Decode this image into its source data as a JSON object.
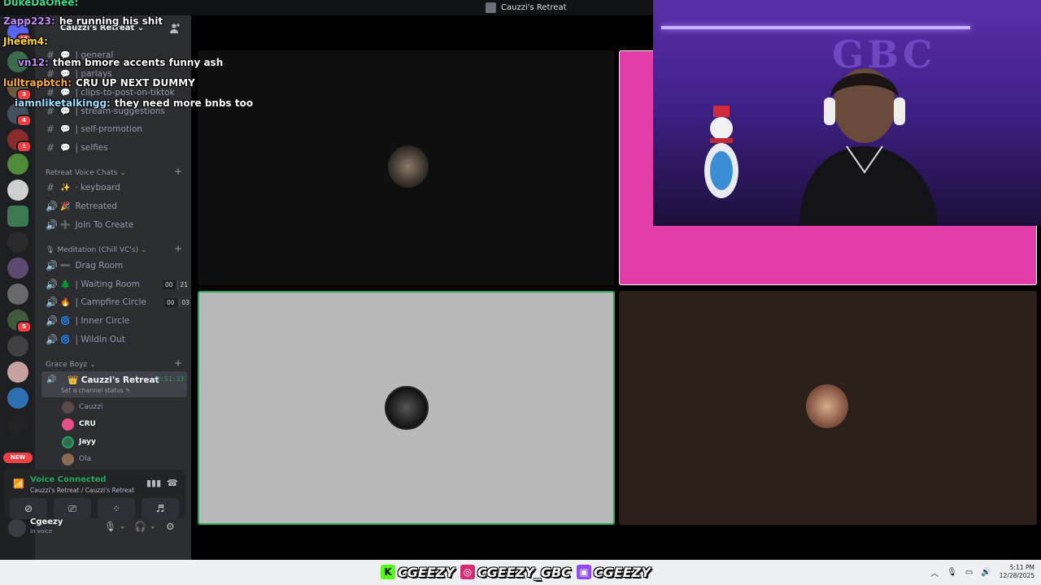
{
  "window": {
    "title": "Cauzzi's Retreat"
  },
  "servers": {
    "badges": [
      "15",
      "3",
      "4",
      "1",
      "5"
    ],
    "new_label": "NEW"
  },
  "server_header": {
    "name": "Cauzzi's Retreat"
  },
  "channels": {
    "text": [
      {
        "emoji": "💬",
        "label": "| general"
      },
      {
        "emoji": "💬",
        "label": "| parlays"
      },
      {
        "emoji": "💬",
        "label": "| clips-to-post-on-tiktok"
      },
      {
        "emoji": "💬",
        "label": "| stream-suggestions"
      },
      {
        "emoji": "💬",
        "label": "| self-promotion"
      },
      {
        "emoji": "💬",
        "label": "| selfies"
      }
    ],
    "cat_retreat": "Retreat Voice Chats",
    "retreat": [
      {
        "emoji": "✨",
        "label": "· keyboard",
        "icon": "#"
      },
      {
        "emoji": "🎉",
        "label": "Retreated",
        "icon": "🔊"
      },
      {
        "emoji": "➕",
        "label": "Join To Create",
        "icon": "🔊"
      }
    ],
    "cat_meditation": "Meditation (Chill VC's)",
    "meditation": [
      {
        "emoji": "➖",
        "label": "Drag Room",
        "c1": "",
        "c2": ""
      },
      {
        "emoji": "🌲",
        "label": "| Waiting Room",
        "c1": "00",
        "c2": "21"
      },
      {
        "emoji": "🔥",
        "label": "| Campfire Circle",
        "c1": "00",
        "c2": "03"
      },
      {
        "emoji": "🌀",
        "label": "| Inner Circle",
        "c1": "",
        "c2": ""
      },
      {
        "emoji": "🌀",
        "label": "| Wildin Out",
        "c1": "",
        "c2": ""
      }
    ],
    "cat_grace": "Grace Boyz",
    "active": {
      "name": "Cauzzi's Retreat",
      "timer": "3:51:33",
      "status": "Set a channel status"
    },
    "members": [
      "Cauzzi",
      "CRU",
      "Jayy",
      "Ola"
    ]
  },
  "voice": {
    "title": "Voice Connected",
    "sub": "Cauzzi's Retreat / Cauzzi's Retreat"
  },
  "user": {
    "name": "Cgeezy",
    "status": "In voice"
  },
  "chat": [
    {
      "user": "DukeDaOnee:",
      "text": "",
      "color": "#3ddc84"
    },
    {
      "user": "Zapp223:",
      "text": "he running his shit",
      "color": "#c78bff"
    },
    {
      "user": "Jheem4:",
      "text": "",
      "color": "#ffd43b"
    },
    {
      "user": "vn12:",
      "text": "them bmore accents funny ash",
      "color": "#c78bff"
    },
    {
      "user": "lulltrapbtch:",
      "text": "CRU UP NEXT DUMMY",
      "color": "#ffa93b"
    },
    {
      "user": "iamnliketalkingg:",
      "text": "they need more bnbs too",
      "color": "#9be0ff"
    }
  ],
  "overlay": {
    "handles": [
      "CGEEZY",
      "CGEEZY_GBC",
      "CGEEZY"
    ],
    "logo": "GBC"
  },
  "tray": {
    "time": "5:11 PM",
    "date": "12/28/2025"
  },
  "colors": {
    "accent_green": "#23a55a",
    "tile_pink": "#e23ca8",
    "tile_gray": "#b9b9b9",
    "tile_brown": "#2b1f1a"
  }
}
